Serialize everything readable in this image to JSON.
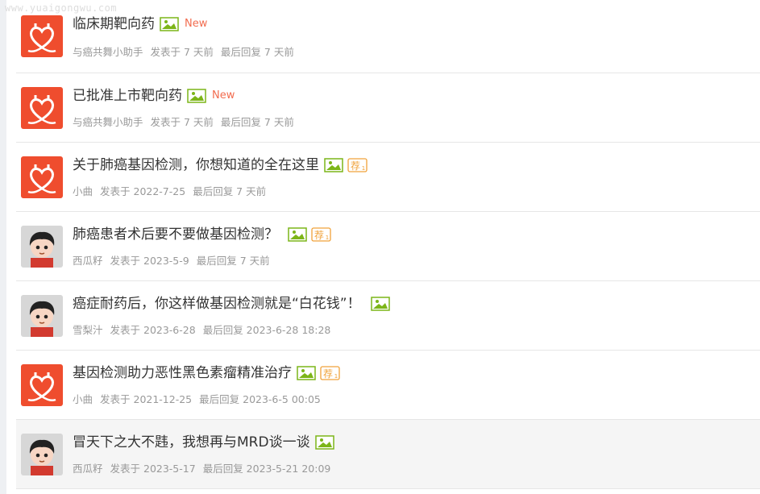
{
  "watermark": "www.yuaigongwu.com",
  "threads": [
    {
      "title": "临床期靶向药",
      "badges": [
        "image",
        "new"
      ],
      "author": "与癌共舞小助手",
      "posted": "发表于 7 天前",
      "last_reply": "最后回复 7 天前",
      "avatar": "logo"
    },
    {
      "title": "已批准上市靶向药",
      "badges": [
        "image",
        "new"
      ],
      "author": "与癌共舞小助手",
      "posted": "发表于 7 天前",
      "last_reply": "最后回复 7 天前",
      "avatar": "logo"
    },
    {
      "title": "关于肺癌基因检测，你想知道的全在这里",
      "badges": [
        "image",
        "recommend"
      ],
      "author": "小曲",
      "posted": "发表于 2022-7-25",
      "last_reply": "最后回复 7 天前",
      "avatar": "logo"
    },
    {
      "title": "肺癌患者术后要不要做基因检测？",
      "badges": [
        "image",
        "recommend"
      ],
      "author": "西瓜籽",
      "posted": "发表于 2023-5-9",
      "last_reply": "最后回复 7 天前",
      "avatar": "person"
    },
    {
      "title": "癌症耐药后，你这样做基因检测就是“白花钱”！",
      "badges": [
        "image"
      ],
      "author": "雪梨汁",
      "posted": "发表于 2023-6-28",
      "last_reply": "最后回复 2023-6-28 18:28",
      "avatar": "person"
    },
    {
      "title": "基因检测助力恶性黑色素瘤精准治疗",
      "badges": [
        "image",
        "recommend"
      ],
      "author": "小曲",
      "posted": "发表于 2021-12-25",
      "last_reply": "最后回复 2023-6-5 00:05",
      "avatar": "logo"
    },
    {
      "title": "冒天下之大不韪，我想再与MRD谈一谈",
      "badges": [
        "image"
      ],
      "author": "西瓜籽",
      "posted": "发表于 2023-5-17",
      "last_reply": "最后回复 2023-5-21 20:09",
      "avatar": "person"
    }
  ],
  "new_label": "New",
  "recommend_label": "荐",
  "recommend_level": "1",
  "colors": {
    "logo_red": "#ef4d2e",
    "image_icon": "#7cb518",
    "recommend": "#f0a23a",
    "new": "#f26c4f"
  }
}
